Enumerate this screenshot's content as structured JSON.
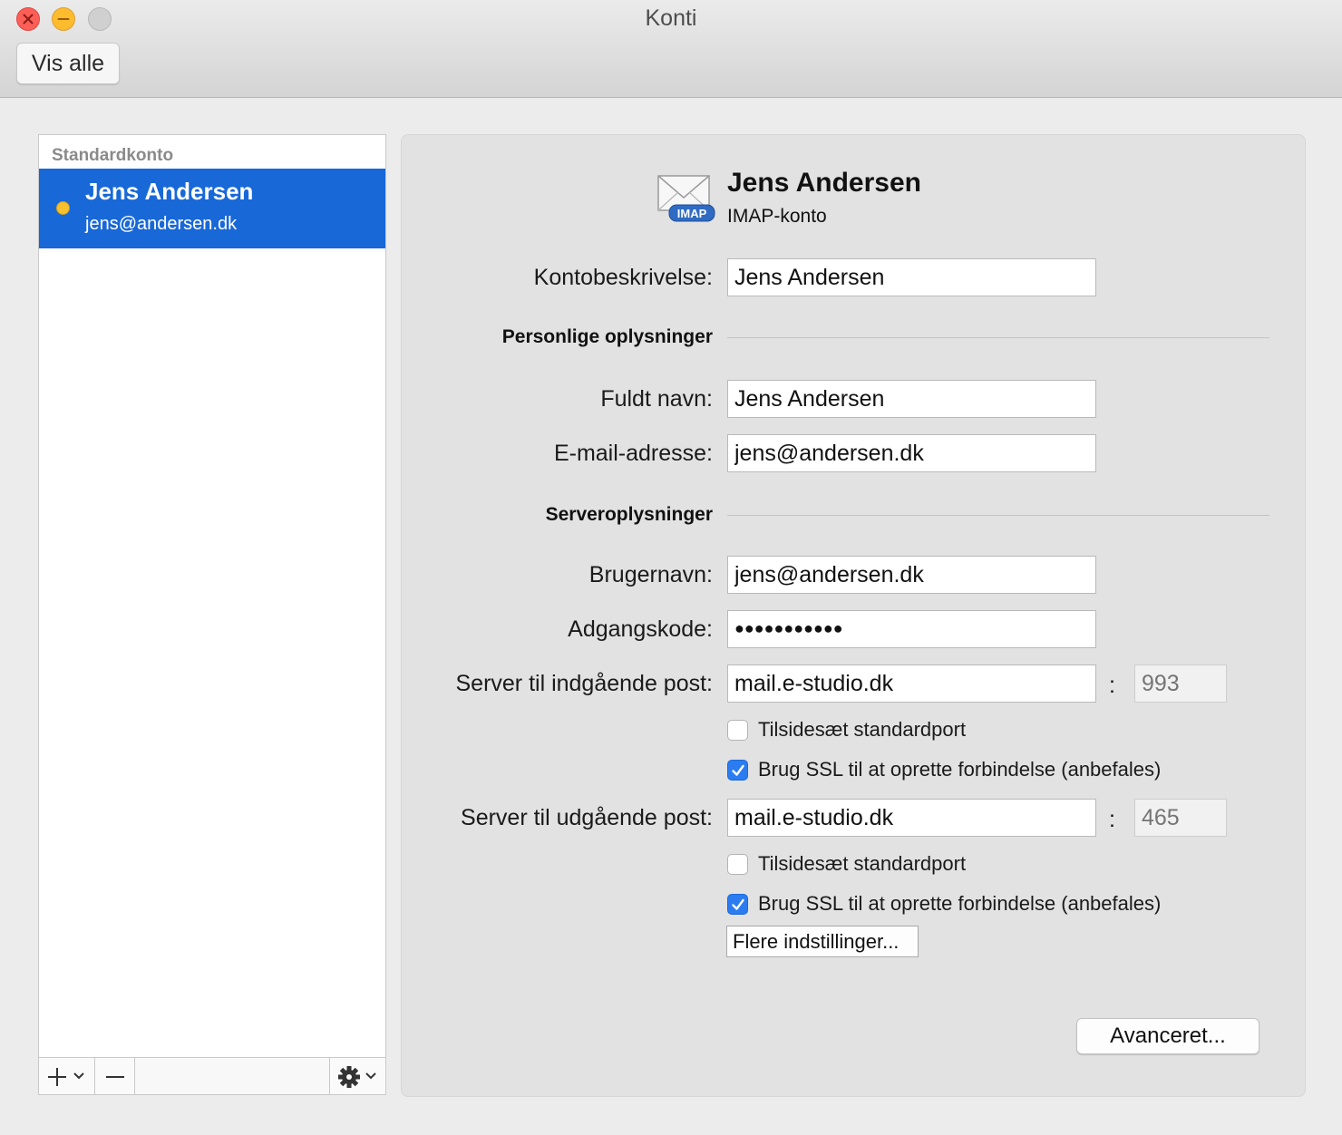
{
  "window": {
    "title": "Konti",
    "show_all_label": "Vis alle"
  },
  "sidebar": {
    "header": "Standardkonto",
    "accounts": [
      {
        "name": "Jens Andersen",
        "email": "jens@andersen.dk",
        "status_color": "#f6c02e",
        "selected": true
      }
    ],
    "add_icon": "plus-chevron-icon",
    "remove_icon": "minus-icon",
    "actions_icon": "gear-chevron-icon"
  },
  "account": {
    "name": "Jens Andersen",
    "type": "IMAP-konto",
    "icon": "imap-mail-icon",
    "icon_badge": "IMAP"
  },
  "form": {
    "description_label": "Kontobeskrivelse:",
    "description_value": "Jens Andersen",
    "personal_section": "Personlige oplysninger",
    "full_name_label": "Fuldt navn:",
    "full_name_value": "Jens Andersen",
    "email_label": "E-mail-adresse:",
    "email_value": "jens@andersen.dk",
    "server_section": "Serveroplysninger",
    "username_label": "Brugernavn:",
    "username_value": "jens@andersen.dk",
    "password_label": "Adgangskode:",
    "password_value": "●●●●●●●●●●●",
    "incoming_label": "Server til indgående post:",
    "incoming_value": "mail.e-studio.dk",
    "incoming_port": "993",
    "incoming_override_label": "Tilsidesæt standardport",
    "incoming_override_checked": false,
    "incoming_ssl_label": "Brug SSL til at oprette forbindelse (anbefales)",
    "incoming_ssl_checked": true,
    "outgoing_label": "Server til udgående post:",
    "outgoing_value": "mail.e-studio.dk",
    "outgoing_port": "465",
    "outgoing_override_label": "Tilsidesæt standardport",
    "outgoing_override_checked": false,
    "outgoing_ssl_label": "Brug SSL til at oprette forbindelse (anbefales)",
    "outgoing_ssl_checked": true,
    "more_settings_label": "Flere indstillinger...",
    "advanced_label": "Avanceret...",
    "colon": ":"
  },
  "colors": {
    "selection": "#1868d8",
    "checkbox_on": "#2a7cf0",
    "close": "#fc5f57",
    "minimize": "#fdbc2e"
  }
}
